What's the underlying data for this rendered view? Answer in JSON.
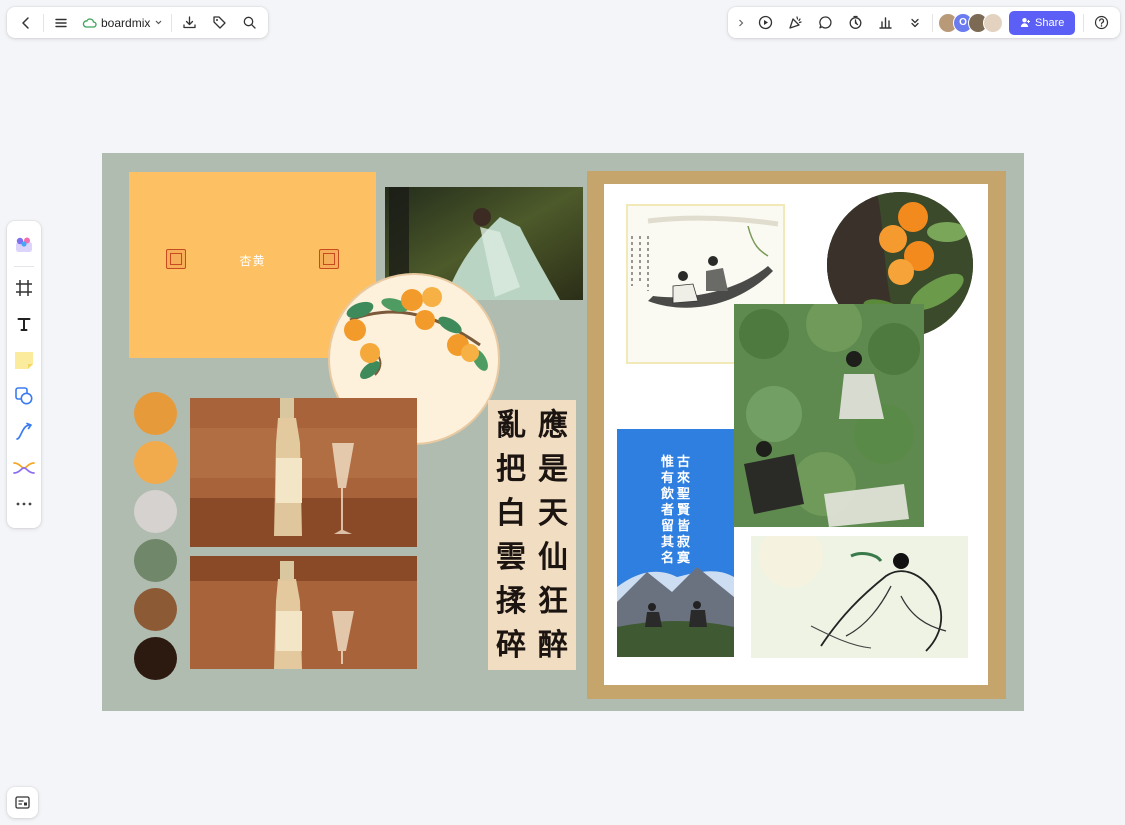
{
  "topbar": {
    "app_name": "boardmix",
    "share_label": "Share",
    "collaborator_extra_initial": "O"
  },
  "board": {
    "apricot_title": "杏黄",
    "calligraphy_columns": [
      [
        "應",
        "是",
        "天",
        "仙",
        "狂",
        "醉"
      ],
      [
        "亂",
        "把",
        "白",
        "雲",
        "揉",
        "碎"
      ]
    ],
    "poem_columns": [
      [
        "古",
        "來",
        "聖",
        "賢",
        "皆",
        "寂",
        "寞"
      ],
      [
        "惟",
        "有",
        "飲",
        "者",
        "留",
        "其",
        "名"
      ]
    ],
    "palette": [
      "#e69a3a",
      "#f2ab4c",
      "#d6d2cf",
      "#70876a",
      "#8c5a35",
      "#2c1a10"
    ]
  },
  "colors": {
    "accent": "#5b5ff5",
    "board_bg": "#b1bcb1",
    "apricot": "#fdc164",
    "frame": "#c6a56d"
  }
}
